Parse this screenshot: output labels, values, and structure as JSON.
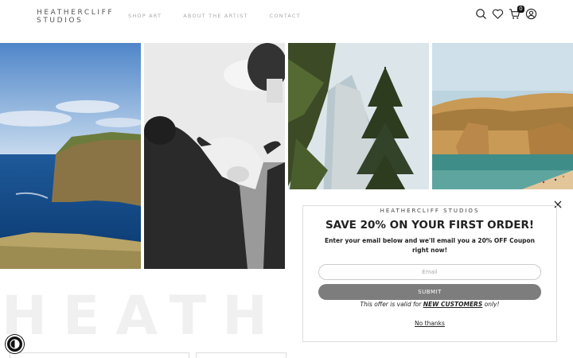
{
  "header": {
    "logo_line1": "HEATHERCLIFF",
    "logo_line2": "STUDIOS",
    "nav": [
      "SHOP ART",
      "ABOUT THE ARTIST",
      "CONTACT"
    ],
    "cart_count": "0",
    "icons": [
      "search-icon",
      "heart-icon",
      "cart-icon",
      "account-icon"
    ]
  },
  "background_word": "HEATHERCLIF",
  "popup": {
    "brand": "HEATHERCLIFF STUDIOS",
    "title": "SAVE 20% ON YOUR FIRST ORDER!",
    "subtitle": "Enter your email below and we'll email you a 20% OFF Coupon right now!",
    "email_placeholder": "Email",
    "submit_label": "SUBMIT",
    "offer_prefix": "This offer is valid for ",
    "offer_bold": "NEW CUSTOMERS",
    "offer_suffix": " only!",
    "no_thanks": "No thanks"
  },
  "colors": {
    "submit_bg": "#7d7d7d",
    "text": "#222222"
  }
}
